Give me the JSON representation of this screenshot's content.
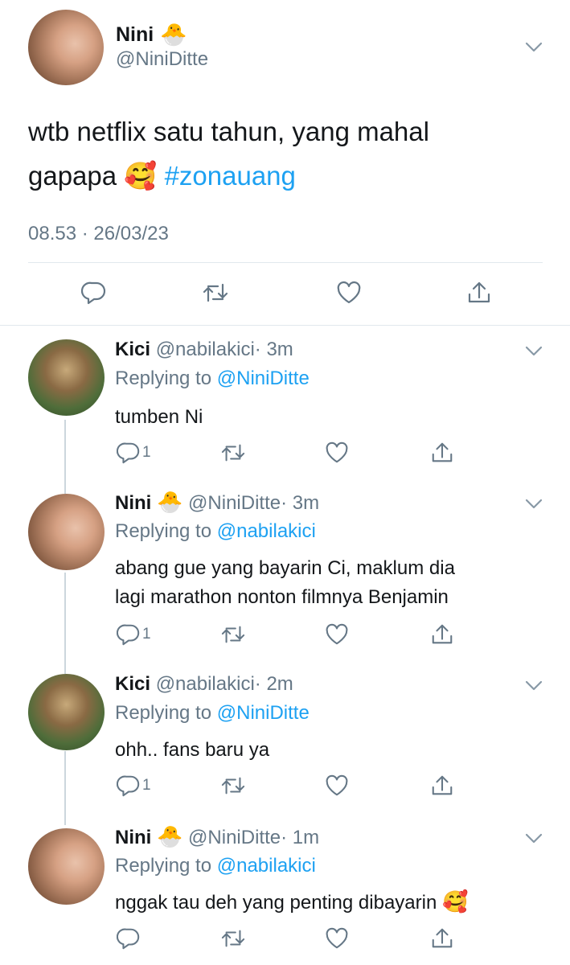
{
  "main_tweet": {
    "name": "Nini",
    "handle": "@NiniDitte",
    "text_line1": "wtb netflix satu tahun, yang mahal",
    "text_line2_prefix": "gapapa",
    "text_emoji": "🥰",
    "hashtag": "#zonauang",
    "timestamp": "08.53 · 26/03/23"
  },
  "replies": [
    {
      "name": "Kici",
      "handle": "@nabilakici",
      "time": "· 3m",
      "replying_label": "Replying to",
      "replying_to": "@NiniDitte",
      "text1": "tumben Ni",
      "text2": "",
      "reply_count": "1"
    },
    {
      "name": "Nini",
      "handle": "@NiniDitte",
      "time": "· 3m",
      "replying_label": "Replying to",
      "replying_to": "@nabilakici",
      "text1": "abang gue yang bayarin Ci, maklum dia",
      "text2": "lagi marathon nonton filmnya Benjamin",
      "reply_count": "1"
    },
    {
      "name": "Kici",
      "handle": "@nabilakici",
      "time": "· 2m",
      "replying_label": "Replying to",
      "replying_to": "@NiniDitte",
      "text1": "ohh.. fans baru ya",
      "text2": "",
      "reply_count": "1"
    },
    {
      "name": "Nini",
      "handle": "@NiniDitte",
      "time": "· 1m",
      "replying_label": "Replying to",
      "replying_to": "@nabilakici",
      "text1": "nggak tau deh yang penting dibayarin",
      "text2": "",
      "emoji": "🥰",
      "reply_count": ""
    }
  ],
  "emoji": {
    "chick": "🐣"
  },
  "colors": {
    "link": "#1da1f2",
    "muted": "#657786",
    "divider": "#e1e8ed",
    "thread_line": "#ccd6dd"
  },
  "icons": [
    "chevron-down-icon",
    "reply-icon",
    "retweet-icon",
    "like-icon",
    "share-icon"
  ]
}
